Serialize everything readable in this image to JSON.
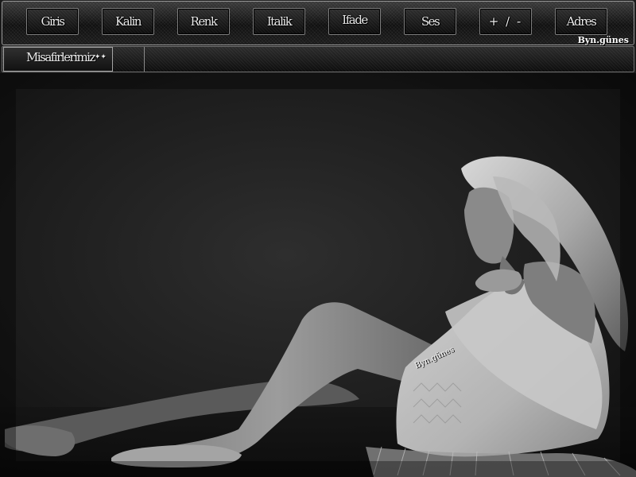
{
  "toolbar": {
    "buttons": [
      {
        "label": "Giris"
      },
      {
        "label": "Kalin"
      },
      {
        "label": "Renk"
      },
      {
        "label": "Italik"
      },
      {
        "label": "Ifade"
      },
      {
        "label": "Ses"
      },
      {
        "label": "+ / -"
      },
      {
        "label": "Adres"
      }
    ],
    "signature": "Byn.günes"
  },
  "guests": {
    "label": "Misafirlerimiz",
    "stars": "✦✦"
  },
  "photo": {
    "watermark": "Byn.günes"
  }
}
